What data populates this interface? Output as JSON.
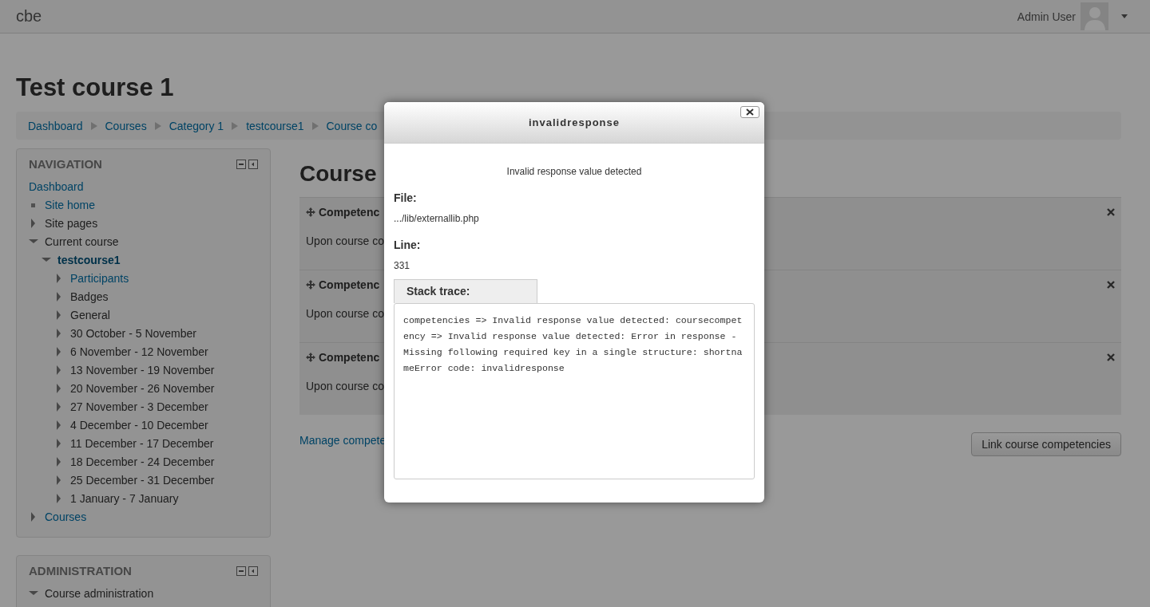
{
  "navbar": {
    "brand": "cbe",
    "user": "Admin User"
  },
  "page": {
    "title": "Test course 1",
    "breadcrumb": [
      "Dashboard",
      "Courses",
      "Category 1",
      "testcourse1",
      "Course co"
    ]
  },
  "navigation": {
    "title": "NAVIGATION",
    "items": [
      {
        "label": "Dashboard",
        "kind": "plain",
        "link": true,
        "active": false
      },
      {
        "label": "Site home",
        "kind": "leaf",
        "link": true,
        "active": false
      },
      {
        "label": "Site pages",
        "kind": "branch",
        "expanded": false,
        "link": false,
        "active": false
      },
      {
        "label": "Current course",
        "kind": "branch",
        "expanded": true,
        "link": false,
        "active": false,
        "children": [
          {
            "label": "testcourse1",
            "kind": "branch",
            "expanded": true,
            "link": true,
            "active": true,
            "children": [
              {
                "label": "Participants",
                "kind": "branch",
                "expanded": false,
                "link": true,
                "active": false
              },
              {
                "label": "Badges",
                "kind": "branch",
                "expanded": false,
                "link": false,
                "active": false
              },
              {
                "label": "General",
                "kind": "branch",
                "expanded": false,
                "link": false,
                "active": false
              },
              {
                "label": "30 October - 5 November",
                "kind": "branch",
                "expanded": false,
                "link": false,
                "active": false
              },
              {
                "label": "6 November - 12 November",
                "kind": "branch",
                "expanded": false,
                "link": false,
                "active": false
              },
              {
                "label": "13 November - 19 November",
                "kind": "branch",
                "expanded": false,
                "link": false,
                "active": false
              },
              {
                "label": "20 November - 26 November",
                "kind": "branch",
                "expanded": false,
                "link": false,
                "active": false
              },
              {
                "label": "27 November - 3 December",
                "kind": "branch",
                "expanded": false,
                "link": false,
                "active": false
              },
              {
                "label": "4 December - 10 December",
                "kind": "branch",
                "expanded": false,
                "link": false,
                "active": false
              },
              {
                "label": "11 December - 17 December",
                "kind": "branch",
                "expanded": false,
                "link": false,
                "active": false
              },
              {
                "label": "18 December - 24 December",
                "kind": "branch",
                "expanded": false,
                "link": false,
                "active": false
              },
              {
                "label": "25 December - 31 December",
                "kind": "branch",
                "expanded": false,
                "link": false,
                "active": false
              },
              {
                "label": "1 January - 7 January",
                "kind": "branch",
                "expanded": false,
                "link": false,
                "active": false
              }
            ]
          }
        ]
      },
      {
        "label": "Courses",
        "kind": "branch",
        "expanded": false,
        "link": true,
        "active": false
      }
    ]
  },
  "administration": {
    "title": "ADMINISTRATION",
    "items": [
      {
        "label": "Course administration",
        "kind": "branch",
        "expanded": true,
        "link": false,
        "active": false
      }
    ]
  },
  "content": {
    "heading": "Course",
    "competencies": [
      {
        "title": "Competenc",
        "description": "Upon course co"
      },
      {
        "title": "Competenc",
        "description": "Upon course co"
      },
      {
        "title": "Competenc",
        "description": "Upon course co"
      }
    ],
    "manage_link": "Manage compete",
    "link_button": "Link course competencies"
  },
  "dialog": {
    "title": "invalidresponse",
    "message": "Invalid response value detected",
    "file_label": "File:",
    "file": ".../lib/externallib.php",
    "line_label": "Line:",
    "line": "331",
    "stack_tab": "Stack trace:",
    "stack_trace": "competencies => Invalid response value detected: coursecompetency => Invalid response value detected: Error in response - Missing following required key in a single structure: shortnameError code: invalidresponse"
  }
}
